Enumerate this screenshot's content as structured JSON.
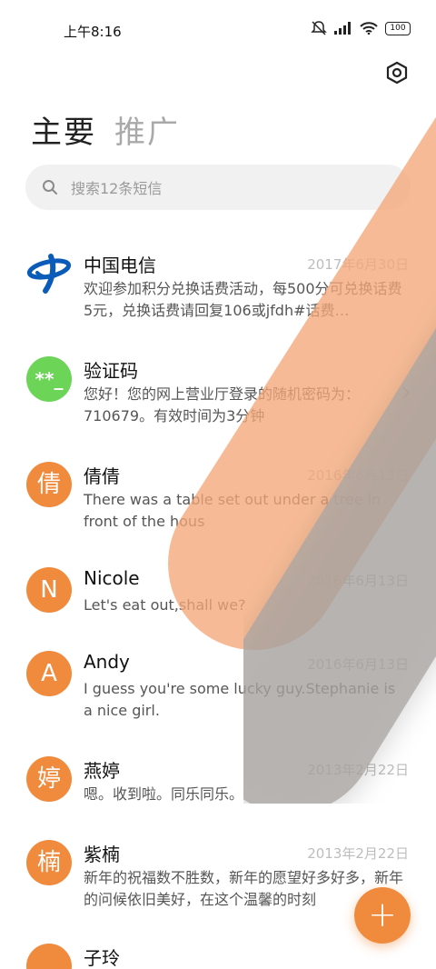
{
  "status_bar": {
    "time": "上午8:16",
    "battery": "100"
  },
  "header": {
    "tabs": [
      {
        "label": "主要"
      },
      {
        "label": "推广"
      }
    ]
  },
  "search": {
    "placeholder": "搜索12条短信"
  },
  "conversations": [
    {
      "name": "中国电信",
      "date": "2017年6月30日",
      "preview": "欢迎参加积分兑换话费活动，每500分可兑换话费5元，兑换话费请回复106或jfdh#话费…",
      "avatar_type": "logo"
    },
    {
      "name": "验证码",
      "date": "",
      "preview": "您好！您的网上营业厅登录的随机密码为：710679。有效时间为3分钟",
      "avatar_text": "**_",
      "avatar_type": "green"
    },
    {
      "name": "倩倩",
      "date": "2016年6月13日",
      "preview": "There was a table set out under a tree in front of the hous",
      "avatar_text": "倩",
      "avatar_type": "orange"
    },
    {
      "name": "Nicole",
      "date": "2016年6月13日",
      "preview": "Let's eat out,shall we?",
      "avatar_text": "N",
      "avatar_type": "orange"
    },
    {
      "name": "Andy",
      "date": "2016年6月13日",
      "preview": "I guess you're some lucky guy.Stephanie is a nice girl.",
      "avatar_text": "A",
      "avatar_type": "orange"
    },
    {
      "name": "燕婷",
      "date": "2013年2月22日",
      "preview": "嗯。收到啦。同乐同乐。",
      "avatar_text": "婷",
      "avatar_type": "orange"
    },
    {
      "name": "紫楠",
      "date": "2013年2月22日",
      "preview": "新年的祝福数不胜数，新年的愿望好多好多，新年的问候依旧美好，在这个温馨的时刻",
      "avatar_text": "楠",
      "avatar_type": "orange"
    },
    {
      "name": "子玲",
      "date": "",
      "preview": "",
      "avatar_text": "",
      "avatar_type": "orange"
    }
  ],
  "fab": {
    "label": "+"
  },
  "colors": {
    "accent": "#f08b3e",
    "green_avatar": "#6cd457",
    "date_text": "#bdbdbd"
  }
}
